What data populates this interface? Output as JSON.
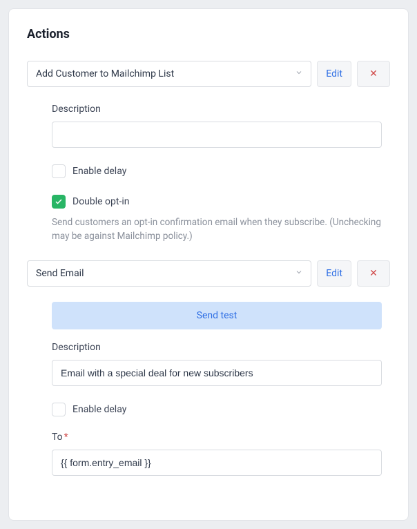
{
  "title": "Actions",
  "actions": [
    {
      "select_label": "Add Customer to Mailchimp List",
      "edit_label": "Edit",
      "delete_symbol": "✕",
      "fields": {
        "description_label": "Description",
        "description_value": "",
        "enable_delay_label": "Enable delay",
        "enable_delay_checked": false,
        "double_optin_label": "Double opt-in",
        "double_optin_checked": true,
        "double_optin_help": "Send customers an opt-in confirmation email when they subscribe. (Unchecking may be against Mailchimp policy.)"
      }
    },
    {
      "select_label": "Send Email",
      "edit_label": "Edit",
      "delete_symbol": "✕",
      "fields": {
        "send_test_label": "Send test",
        "description_label": "Description",
        "description_value": "Email with a special deal for new subscribers",
        "enable_delay_label": "Enable delay",
        "enable_delay_checked": false,
        "to_label": "To",
        "to_required": true,
        "to_value": "{{ form.entry_email }}"
      }
    }
  ]
}
